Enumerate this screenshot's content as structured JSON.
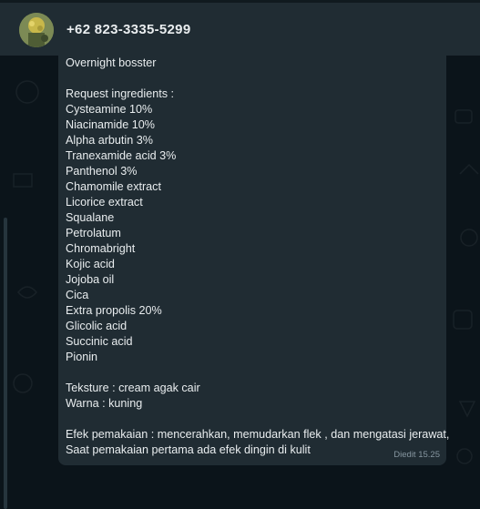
{
  "contact": {
    "name": "+62 823-3335-5299"
  },
  "message": {
    "lines": [
      "Overnight bosster",
      "",
      "Request ingredients :",
      "Cysteamine 10%",
      "Niacinamide 10%",
      "Alpha arbutin 3%",
      "Tranexamide acid 3%",
      "Panthenol 3%",
      "Chamomile extract",
      "Licorice extract",
      "Squalane",
      "Petrolatum",
      "Chromabright",
      "Kojic acid",
      "Jojoba oil",
      "Cica",
      "Extra propolis 20%",
      "Glicolic acid",
      "Succinic acid",
      "Pionin",
      "",
      "Teksture : cream agak cair",
      "Warna : kuning",
      "",
      "Efek pemakaian : mencerahkan, memudarkan flek , dan mengatasi jerawat,",
      "Saat pemakaian pertama ada efek dingin di kulit"
    ],
    "edited_label": "Diedit",
    "time": "15.25"
  },
  "colors": {
    "header_bg": "#202c33",
    "chat_bg": "#0b141a",
    "bubble_bg": "#202c33",
    "text": "#e9edef",
    "meta": "#8696a0"
  }
}
